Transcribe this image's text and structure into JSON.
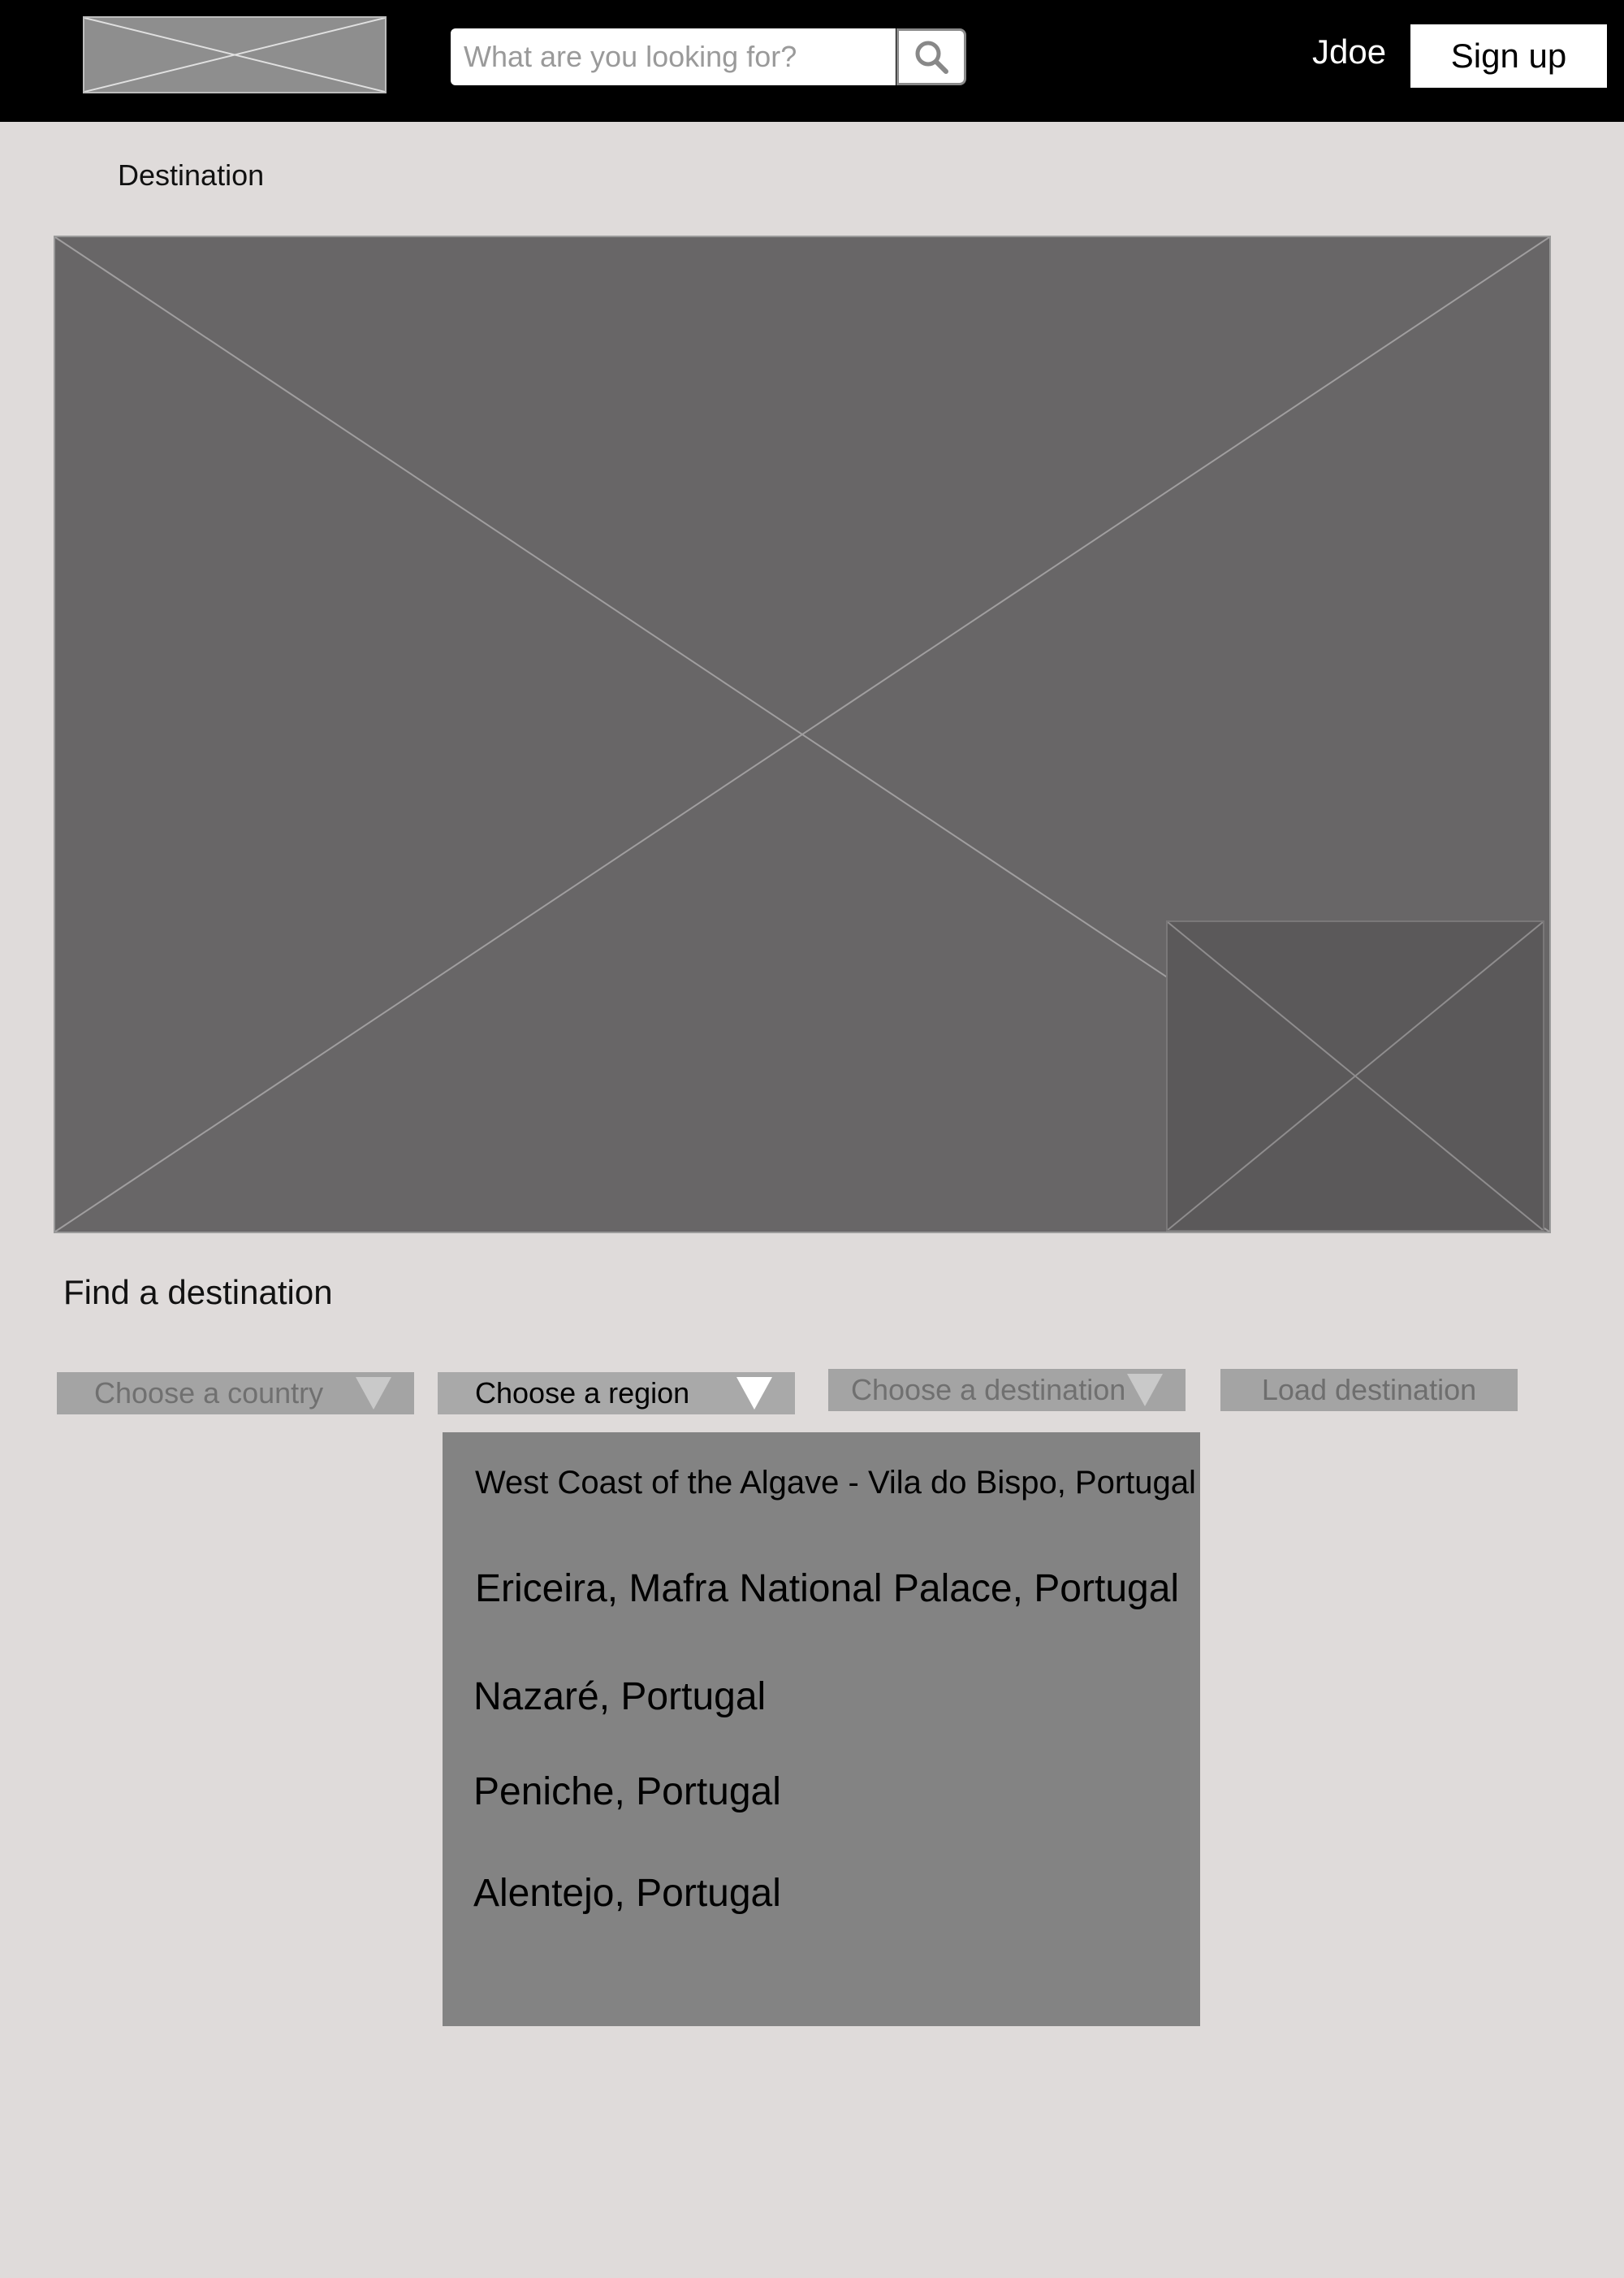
{
  "header": {
    "logo_icon": "image-placeholder-icon",
    "search": {
      "placeholder": "What are you looking for?",
      "icon": "search-icon"
    },
    "username": "Jdoe",
    "signup_label": "Sign up"
  },
  "breadcrumb": "Destination",
  "hero": {
    "icon": "image-placeholder-icon",
    "thumbnail_icon": "image-placeholder-icon"
  },
  "finder": {
    "title": "Find a destination",
    "country_placeholder": "Choose a country",
    "region_label": "Choose a region",
    "destination_placeholder": "Choose a destination",
    "load_label": "Load destination",
    "region_options": [
      "West Coast of the Algave - Vila do Bispo, Portugal",
      "Ericeira, Mafra National Palace, Portugal",
      "Nazaré, Portugal",
      "Peniche, Portugal",
      "Alentejo, Portugal"
    ]
  },
  "colors": {
    "header_bg": "#000000",
    "page_bg": "#dfdbda",
    "placeholder_image": "#686667",
    "dropdown_bg": "#a4a4a4",
    "list_bg": "#838383"
  }
}
